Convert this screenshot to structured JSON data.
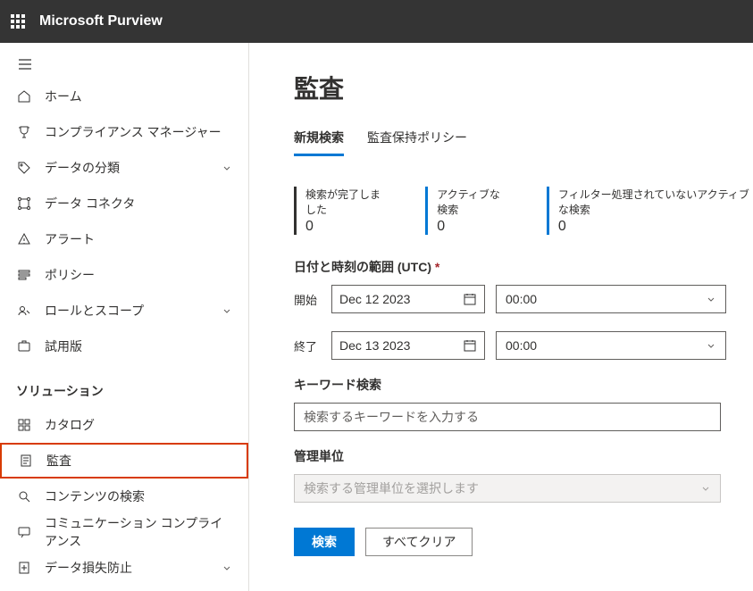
{
  "topbar": {
    "brand": "Microsoft Purview"
  },
  "sidebar": {
    "items_top": [
      {
        "icon": "home",
        "label": "ホーム",
        "chevron": false
      },
      {
        "icon": "trophy",
        "label": "コンプライアンス マネージャー",
        "chevron": false
      },
      {
        "icon": "tag",
        "label": "データの分類",
        "chevron": true
      },
      {
        "icon": "connector",
        "label": "データ コネクタ",
        "chevron": false
      },
      {
        "icon": "alert",
        "label": "アラート",
        "chevron": false
      },
      {
        "icon": "policy",
        "label": "ポリシー",
        "chevron": false
      },
      {
        "icon": "roles",
        "label": "ロールとスコープ",
        "chevron": true
      },
      {
        "icon": "trial",
        "label": "試用版",
        "chevron": false
      }
    ],
    "section_title": "ソリューション",
    "items_bottom": [
      {
        "icon": "catalog",
        "label": "カタログ",
        "chevron": false,
        "highlighted": false
      },
      {
        "icon": "audit",
        "label": "監査",
        "chevron": false,
        "highlighted": true
      },
      {
        "icon": "search",
        "label": "コンテンツの検索",
        "chevron": false
      },
      {
        "icon": "comm",
        "label": "コミュニケーション コンプライアンス",
        "chevron": false
      },
      {
        "icon": "dlp",
        "label": "データ損失防止",
        "chevron": true
      }
    ]
  },
  "main": {
    "title": "監査",
    "tabs": [
      {
        "label": "新規検索",
        "active": true
      },
      {
        "label": "監査保持ポリシー",
        "active": false
      }
    ],
    "stats": [
      {
        "label": "検索が完了しました",
        "value": "0"
      },
      {
        "label": "アクティブな検索",
        "value": "0"
      },
      {
        "label": "フィルター処理されていないアクティブな検索",
        "value": "0"
      }
    ],
    "daterange": {
      "section_label": "日付と時刻の範囲 (UTC)",
      "required_mark": "*",
      "start_label": "開始",
      "start_date": "Dec 12 2023",
      "start_time": "00:00",
      "end_label": "終了",
      "end_date": "Dec 13 2023",
      "end_time": "00:00"
    },
    "keyword": {
      "label": "キーワード検索",
      "placeholder": "検索するキーワードを入力する",
      "value": ""
    },
    "admin_unit": {
      "label": "管理単位",
      "placeholder": "検索する管理単位を選択します"
    },
    "buttons": {
      "search": "検索",
      "clear": "すべてクリア"
    }
  }
}
